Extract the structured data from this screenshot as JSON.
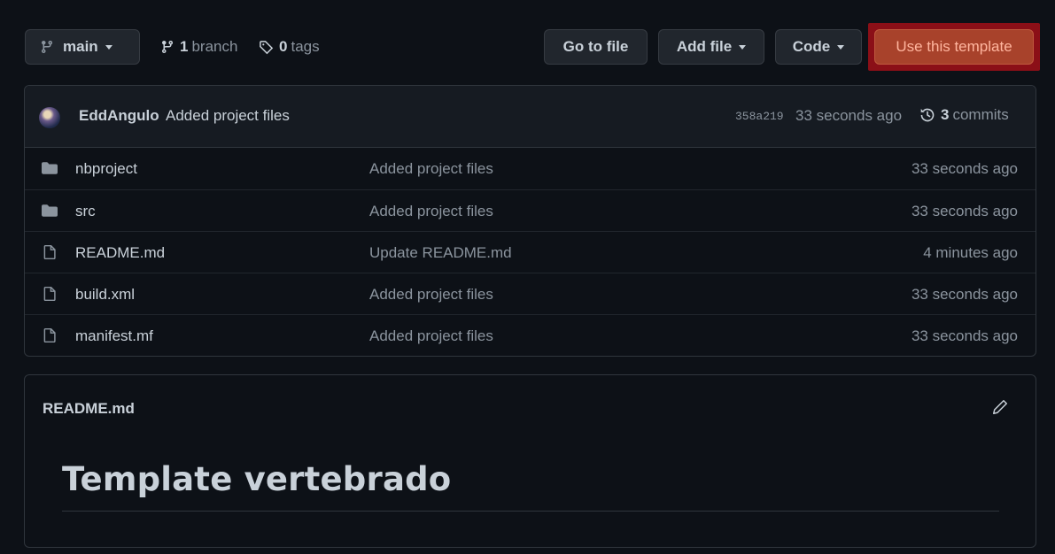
{
  "toolbar": {
    "branch_label": "main",
    "branches_count": "1",
    "branches_word": "branch",
    "tags_count": "0",
    "tags_word": "tags",
    "goto_label": "Go to file",
    "addfile_label": "Add file",
    "code_label": "Code",
    "template_label": "Use this template"
  },
  "commit": {
    "author": "EddAngulo",
    "message": "Added project files",
    "sha": "358a219",
    "time": "33 seconds ago",
    "commits_count": "3",
    "commits_word": "commits"
  },
  "files": [
    {
      "type": "folder",
      "name": "nbproject",
      "commit": "Added project files",
      "time": "33 seconds ago"
    },
    {
      "type": "folder",
      "name": "src",
      "commit": "Added project files",
      "time": "33 seconds ago"
    },
    {
      "type": "file",
      "name": "README.md",
      "commit": "Update README.md",
      "time": "4 minutes ago"
    },
    {
      "type": "file",
      "name": "build.xml",
      "commit": "Added project files",
      "time": "33 seconds ago"
    },
    {
      "type": "file",
      "name": "manifest.mf",
      "commit": "Added project files",
      "time": "33 seconds ago"
    }
  ],
  "readme": {
    "title": "README.md",
    "heading": "Template vertebrado"
  },
  "colors": {
    "background": "#0d1117",
    "border": "#30363d",
    "template_highlight": "#8b0f17",
    "template_button": "#a8422b"
  }
}
